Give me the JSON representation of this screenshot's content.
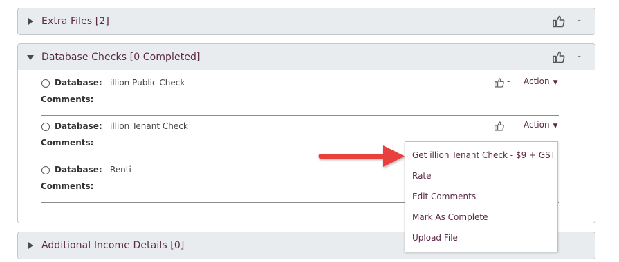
{
  "panels": {
    "extra_files": {
      "title": "Extra Files [2]",
      "dash": "-"
    },
    "database_checks": {
      "title": "Database Checks [0 Completed]",
      "dash": "-"
    },
    "additional_income": {
      "title": "Additional Income Details [0]"
    }
  },
  "db_rows": [
    {
      "label": "Database:",
      "value": "illion Public Check",
      "comments": "Comments:",
      "dash": "-",
      "action": "Action"
    },
    {
      "label": "Database:",
      "value": "illion Tenant Check",
      "comments": "Comments:",
      "dash": "-",
      "action": "Action"
    },
    {
      "label": "Database:",
      "value": "Renti",
      "comments": "Comments:"
    }
  ],
  "action_menu": {
    "items": [
      "Get illion Tenant Check - $9 + GST",
      "Rate",
      "Edit Comments",
      "Mark As Complete",
      "Upload File"
    ]
  },
  "colors": {
    "accent": "#5b2a45",
    "header_bg": "#e9ecee",
    "arrow": "#e8413c"
  },
  "icons": {
    "expand_collapse": "caret-icon",
    "rating": "thumbs-up-icon",
    "dropdown": "caret-down-icon"
  }
}
